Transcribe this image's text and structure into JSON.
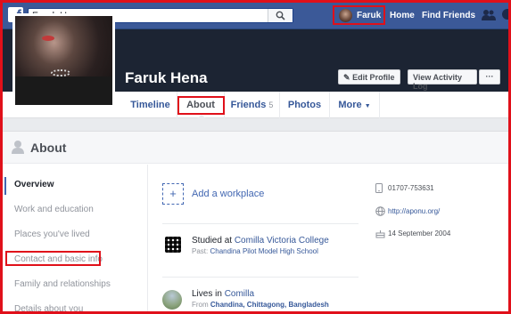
{
  "topbar": {
    "logo": "f",
    "search_value": "Faruk Hena",
    "profile_label": "Faruk",
    "home_label": "Home",
    "find_friends_label": "Find Friends",
    "icons": [
      "facebook-logo-icon",
      "search-icon",
      "friend-requests-icon",
      "messages-icon"
    ]
  },
  "profile": {
    "name": "Faruk Hena",
    "edit_profile_label": "Edit Profile",
    "activity_log_label": "View Activity Log",
    "more_dots": "···"
  },
  "tabs": [
    {
      "label": "Timeline"
    },
    {
      "label": "About",
      "active": true
    },
    {
      "label": "Friends",
      "count": "5"
    },
    {
      "label": "Photos"
    },
    {
      "label": "More"
    }
  ],
  "about": {
    "title": "About",
    "sidebar": [
      {
        "label": "Overview",
        "active": true
      },
      {
        "label": "Work and education"
      },
      {
        "label": "Places you've lived"
      },
      {
        "label": "Contact and basic info"
      },
      {
        "label": "Family and relationships"
      },
      {
        "label": "Details about you"
      }
    ],
    "add_workplace": "Add a workplace",
    "studied_prefix": "Studied at",
    "studied_school": "Comilla Victoria College",
    "past_prefix": "Past:",
    "past_school": "Chandina Pilot Model High School",
    "lives_prefix": "Lives in",
    "lives_city": "Comilla",
    "from_prefix": "From",
    "from_place": "Chandina, Chittagong, Bangladesh",
    "phone": "01707-753631",
    "website": "http://aponu.org/",
    "birthday": "14 September 2004"
  },
  "colors": {
    "brand_blue": "#3b5998",
    "annotation_red": "#e0101a",
    "link_blue": "#365899"
  }
}
